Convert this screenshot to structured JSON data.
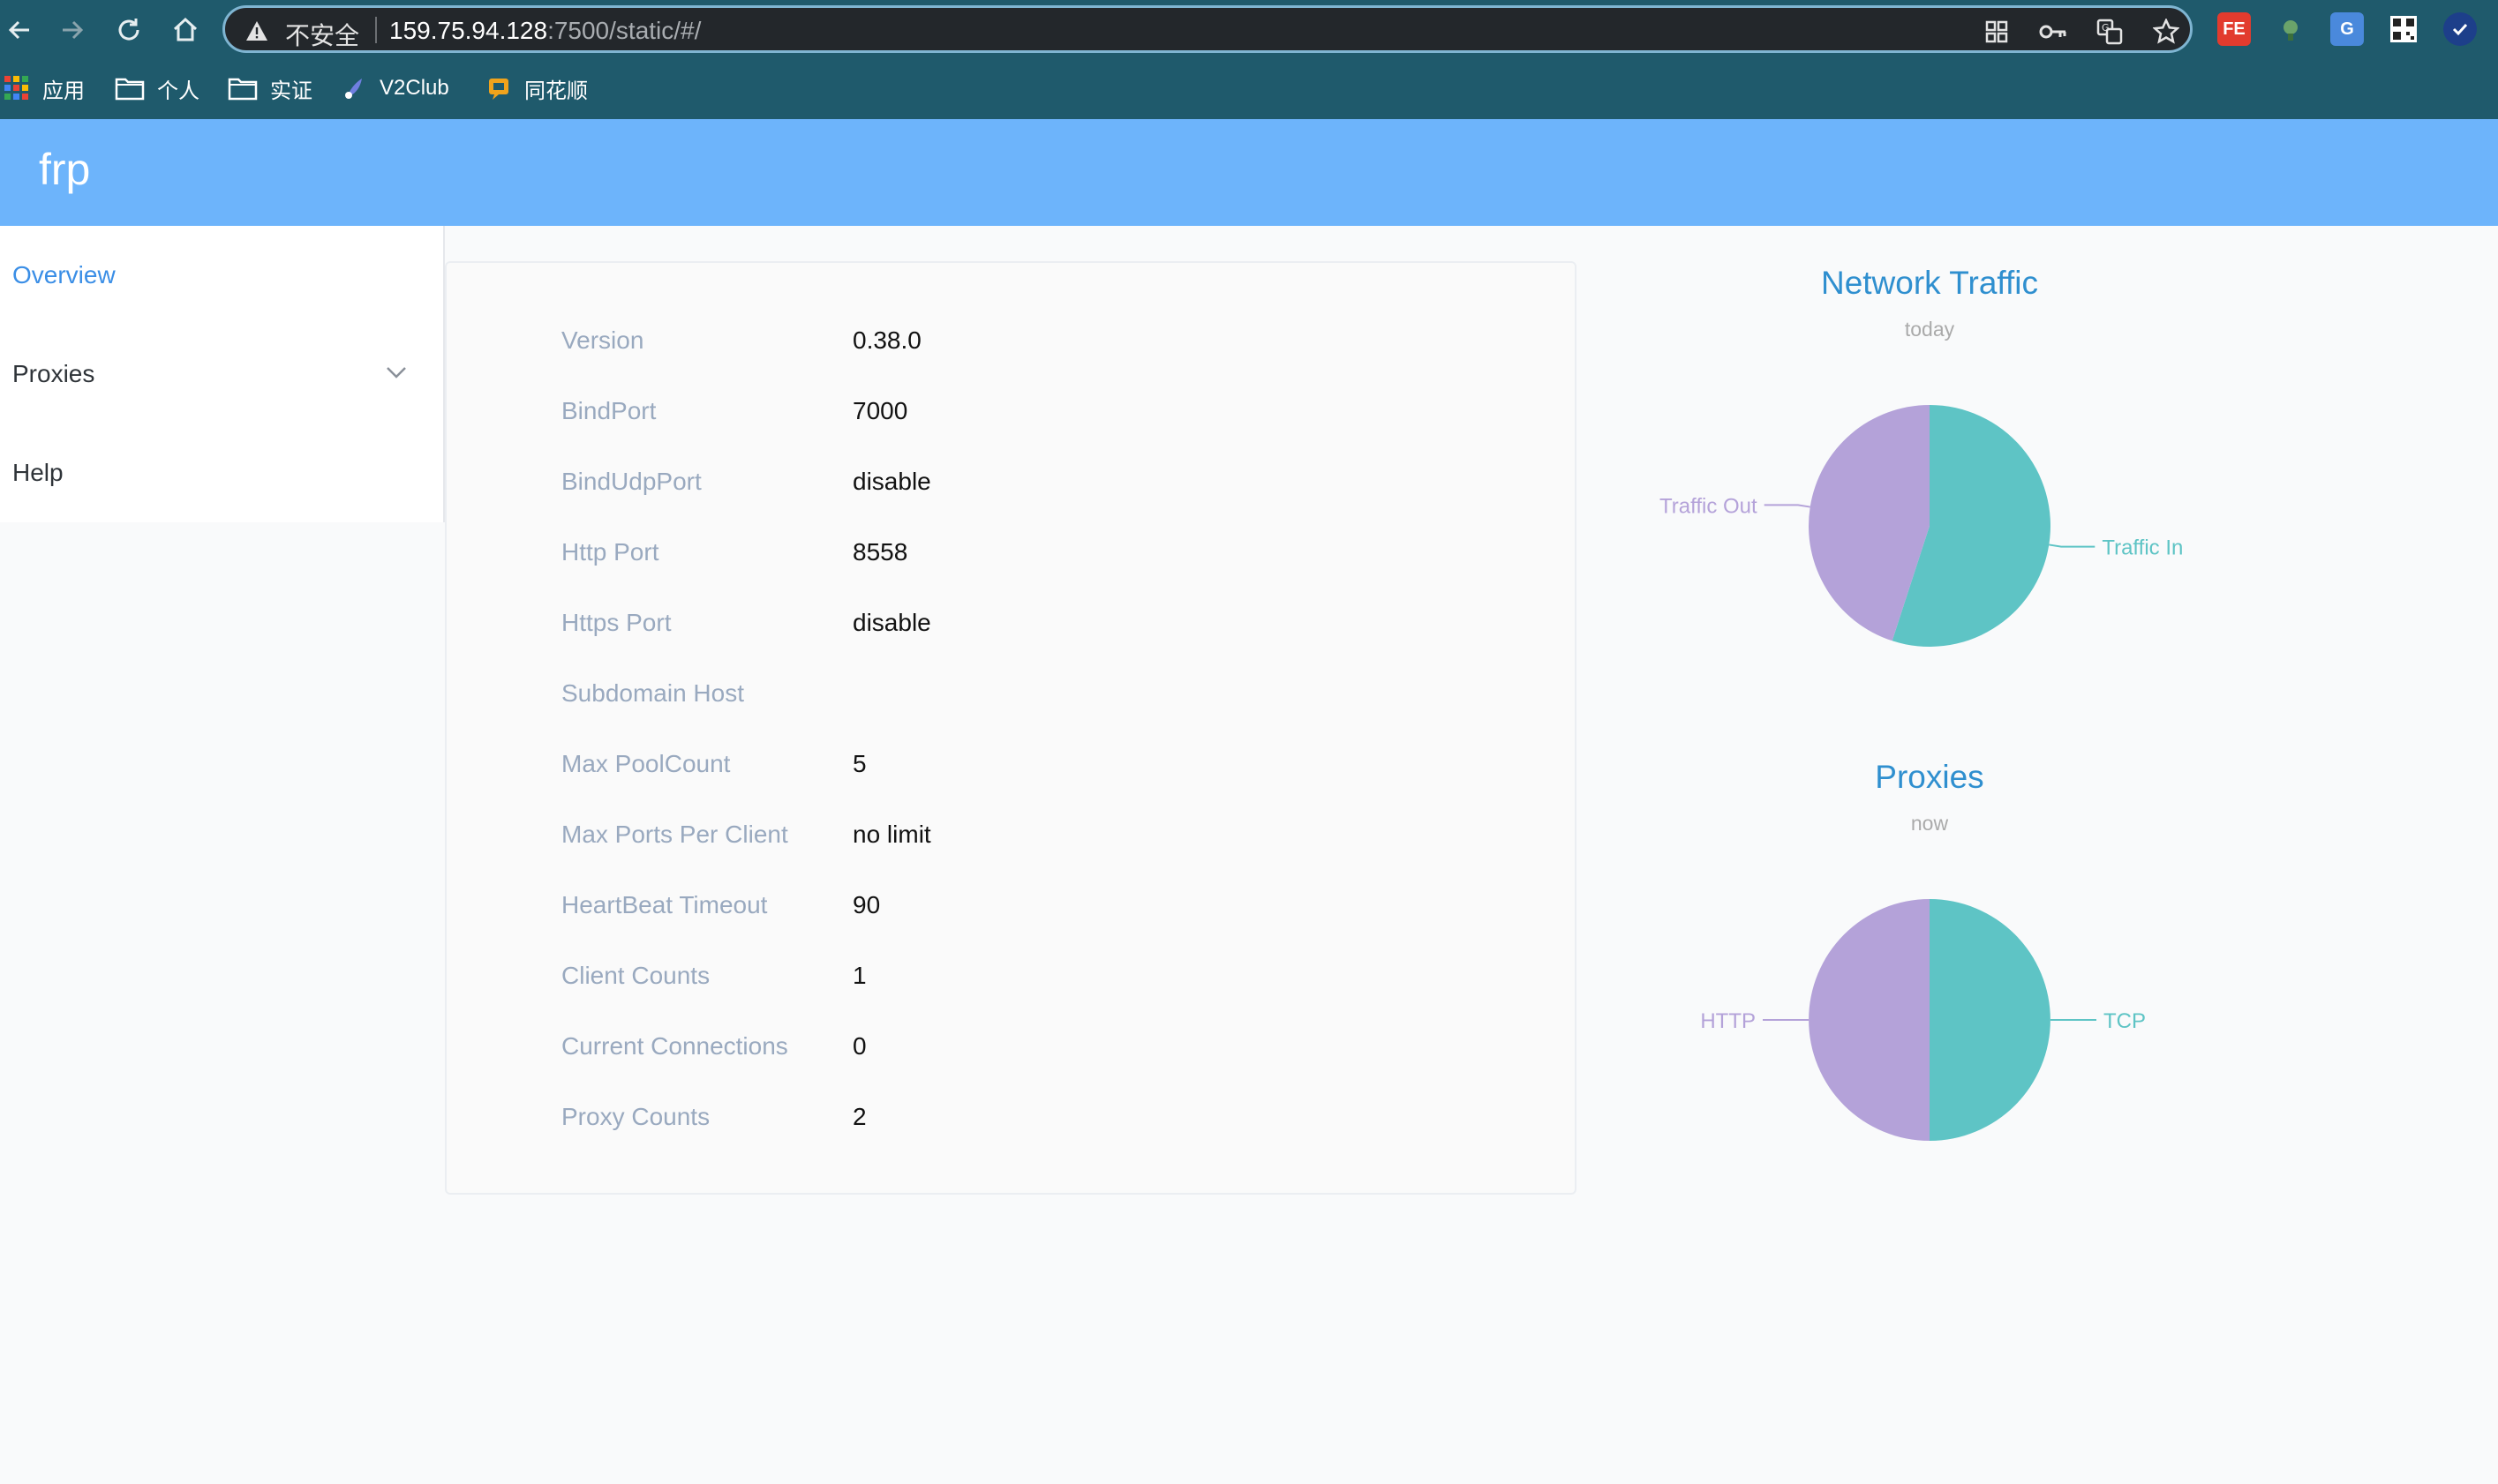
{
  "browser": {
    "security_label": "不安全",
    "url_host": "159.75.94.128",
    "url_rest": ":7500/static/#/",
    "extension_icons": [
      "fe-icon",
      "bird-icon",
      "google-translate-icon",
      "qr-icon",
      "check-badge-icon"
    ],
    "bookmarks": [
      {
        "label": "应用",
        "icon": "apps-grid-icon"
      },
      {
        "label": "个人",
        "icon": "folder-icon"
      },
      {
        "label": "实证",
        "icon": "folder-icon"
      },
      {
        "label": "V2Club",
        "icon": "v2club-icon"
      },
      {
        "label": "同花顺",
        "icon": "tonghuashun-icon"
      }
    ],
    "colors": {
      "chrome": "#1f5a6c",
      "omnibox": "#23272b",
      "omnibox_border": "#7fb5d2"
    }
  },
  "header": {
    "brand": "frp",
    "color": "#6db4fb"
  },
  "sidebar": {
    "items": [
      {
        "label": "Overview",
        "active": true
      },
      {
        "label": "Proxies",
        "active": false,
        "expandable": true
      },
      {
        "label": "Help",
        "active": false
      }
    ],
    "active_color": "#3a8ee6"
  },
  "overview": {
    "rows": [
      {
        "label": "Version",
        "value": "0.38.0"
      },
      {
        "label": "BindPort",
        "value": "7000"
      },
      {
        "label": "BindUdpPort",
        "value": "disable"
      },
      {
        "label": "Http Port",
        "value": "8558"
      },
      {
        "label": "Https Port",
        "value": "disable"
      },
      {
        "label": "Subdomain Host",
        "value": ""
      },
      {
        "label": "Max PoolCount",
        "value": "5"
      },
      {
        "label": "Max Ports Per Client",
        "value": "no limit"
      },
      {
        "label": "HeartBeat Timeout",
        "value": "90"
      },
      {
        "label": "Client Counts",
        "value": "1"
      },
      {
        "label": "Current Connections",
        "value": "0"
      },
      {
        "label": "Proxy Counts",
        "value": "2"
      }
    ]
  },
  "chart_data": [
    {
      "type": "pie",
      "title": "Network Traffic",
      "subtitle": "today",
      "slices": [
        {
          "label": "Traffic In",
          "value": 55,
          "color": "#5ec4c5"
        },
        {
          "label": "Traffic Out",
          "value": 45,
          "color": "#b4a2d9"
        }
      ]
    },
    {
      "type": "pie",
      "title": "Proxies",
      "subtitle": "now",
      "slices": [
        {
          "label": "TCP",
          "value": 1,
          "color": "#5ec4c5"
        },
        {
          "label": "HTTP",
          "value": 1,
          "color": "#b4a2d9"
        }
      ]
    }
  ]
}
